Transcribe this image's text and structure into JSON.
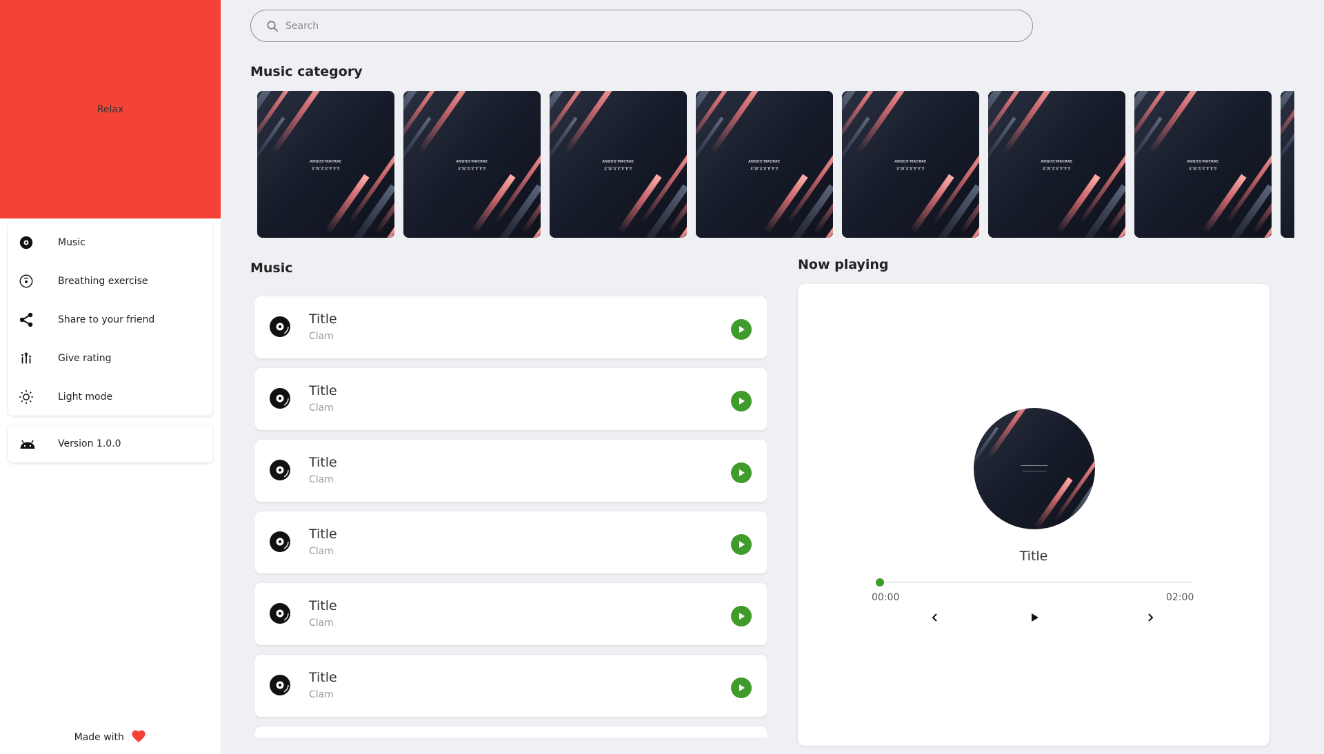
{
  "brand": {
    "title": "Relax",
    "color": "#f44336"
  },
  "sidebar": {
    "items": [
      {
        "label": "Music",
        "icon": "disc-icon"
      },
      {
        "label": "Breathing exercise",
        "icon": "breathing-icon"
      },
      {
        "label": "Share to your friend",
        "icon": "share-icon"
      },
      {
        "label": "Give rating",
        "icon": "rating-icon"
      },
      {
        "label": "Light mode",
        "icon": "sun-icon"
      }
    ],
    "version": {
      "label": "Version 1.0.0",
      "icon": "android-icon"
    },
    "footer": {
      "label": "Made with",
      "icon": "heart-icon"
    }
  },
  "search": {
    "placeholder": "Search",
    "value": ""
  },
  "categories": {
    "heading": "Music category",
    "album_artist": "ANGUS MACRAE",
    "album_name": "A W A K E   E P",
    "count_visible": 8
  },
  "music": {
    "heading": "Music",
    "tracks": [
      {
        "title": "Title",
        "subtitle": "Clam"
      },
      {
        "title": "Title",
        "subtitle": "Clam"
      },
      {
        "title": "Title",
        "subtitle": "Clam"
      },
      {
        "title": "Title",
        "subtitle": "Clam"
      },
      {
        "title": "Title",
        "subtitle": "Clam"
      },
      {
        "title": "Title",
        "subtitle": "Clam"
      }
    ]
  },
  "now_playing": {
    "heading": "Now playing",
    "title": "Title",
    "current_time": "00:00",
    "total_time": "02:00",
    "progress": 0
  },
  "colors": {
    "accent": "#3f9b2c",
    "heart": "#f44336",
    "background": "#eff0f4"
  }
}
